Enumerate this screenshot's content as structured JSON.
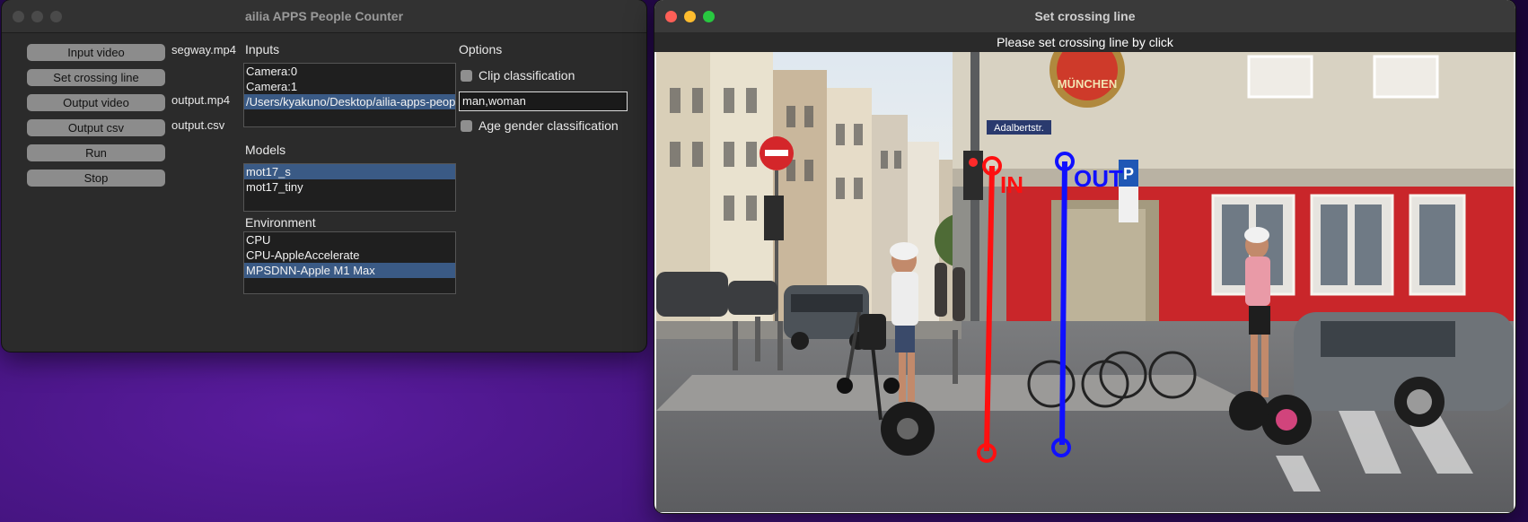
{
  "left_window": {
    "title": "ailia APPS People Counter",
    "buttons": {
      "input_video": "Input video",
      "set_crossing_line": "Set crossing line",
      "output_video": "Output video",
      "output_csv": "Output csv",
      "run": "Run",
      "stop": "Stop"
    },
    "files": {
      "input": "segway.mp4",
      "output_video": "output.mp4",
      "output_csv": "output.csv"
    },
    "inputs": {
      "heading": "Inputs",
      "items": [
        "Camera:0",
        "Camera:1",
        "/Users/kyakuno/Desktop/ailia-apps-people-counter"
      ],
      "selected_index": 2
    },
    "models": {
      "heading": "Models",
      "items": [
        "mot17_s",
        "mot17_tiny"
      ],
      "selected_index": 0
    },
    "environment": {
      "heading": "Environment",
      "items": [
        "CPU",
        "CPU-AppleAccelerate",
        "MPSDNN-Apple M1 Max"
      ],
      "selected_index": 2
    },
    "options": {
      "heading": "Options",
      "clip_classification_label": "Clip classification",
      "clip_classification_checked": false,
      "clip_text_value": "man,woman",
      "age_gender_label": "Age gender classification",
      "age_gender_checked": false
    }
  },
  "right_window": {
    "title": "Set crossing line",
    "prompt": "Please set crossing line by click",
    "line_labels": {
      "in": "IN",
      "out": "OUT"
    },
    "scene_text": {
      "street_sign": "Adalbertstr.",
      "shop_sign": "MÜNCHEN",
      "parking_sign": "P"
    },
    "colors": {
      "in_line": "#ff1010",
      "out_line": "#1010ff"
    }
  }
}
